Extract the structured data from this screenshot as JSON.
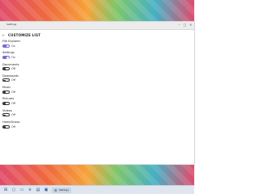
{
  "window": {
    "title": "Settings",
    "header": "CUSTOMIZE LIST"
  },
  "items": [
    {
      "label": "File Explorer",
      "state": "On",
      "on": true
    },
    {
      "label": "Settings",
      "state": "On",
      "on": true
    },
    {
      "label": "Documents",
      "state": "Off",
      "on": false
    },
    {
      "label": "Downloads",
      "state": "Off",
      "on": false
    },
    {
      "label": "Music",
      "state": "Off",
      "on": false
    },
    {
      "label": "Pictures",
      "state": "Off",
      "on": false
    },
    {
      "label": "Videos",
      "state": "Off",
      "on": false
    },
    {
      "label": "HomeGroup",
      "state": "Off",
      "on": false
    }
  ],
  "taskbar": {
    "active_app": "Settings"
  },
  "colors": {
    "accent": "#7c6bcf"
  }
}
